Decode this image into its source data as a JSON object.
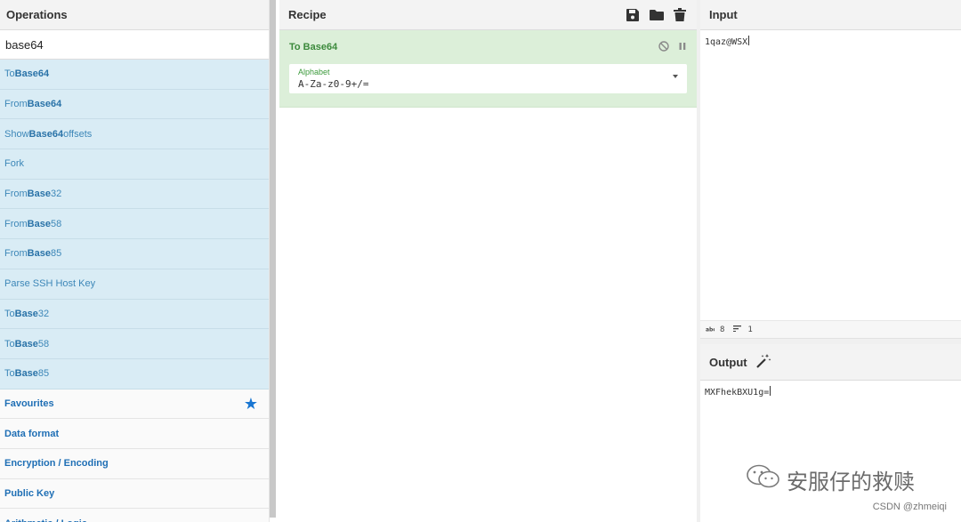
{
  "operations": {
    "title": "Operations",
    "search_value": "base64",
    "results": [
      {
        "pre": "To ",
        "bold": "Base64",
        "post": ""
      },
      {
        "pre": "From ",
        "bold": "Base64",
        "post": ""
      },
      {
        "pre": "Show ",
        "bold": "Base64",
        "post": " offsets"
      },
      {
        "pre": "Fork",
        "bold": "",
        "post": ""
      },
      {
        "pre": "From ",
        "bold": "Base",
        "post": "32"
      },
      {
        "pre": "From ",
        "bold": "Base",
        "post": "58"
      },
      {
        "pre": "From ",
        "bold": "Base",
        "post": "85"
      },
      {
        "pre": "Parse SSH Host Key",
        "bold": "",
        "post": ""
      },
      {
        "pre": "To ",
        "bold": "Base",
        "post": "32"
      },
      {
        "pre": "To ",
        "bold": "Base",
        "post": "58"
      },
      {
        "pre": "To ",
        "bold": "Base",
        "post": "85"
      }
    ],
    "categories": [
      "Favourites",
      "Data format",
      "Encryption / Encoding",
      "Public Key",
      "Arithmetic / Logic"
    ]
  },
  "recipe": {
    "title": "Recipe",
    "icons": [
      "save-icon",
      "folder-icon",
      "trash-icon"
    ],
    "operation": {
      "name": "To Base64",
      "alphabet_label": "Alphabet",
      "alphabet_value": "A-Za-z0-9+/="
    }
  },
  "input": {
    "title": "Input",
    "value": "1qaz@WSX",
    "length": "8",
    "lines": "1"
  },
  "output": {
    "title": "Output",
    "value": "MXFhekBXU1g="
  },
  "watermark": {
    "text": "安服仔的救赎",
    "credit": "CSDN @zhmeiqi"
  },
  "colors": {
    "op_highlight": "#d9ecf5",
    "recipe_op_bg": "#dcefd9",
    "category_text": "#1f6fb5",
    "star": "#1976d2"
  }
}
